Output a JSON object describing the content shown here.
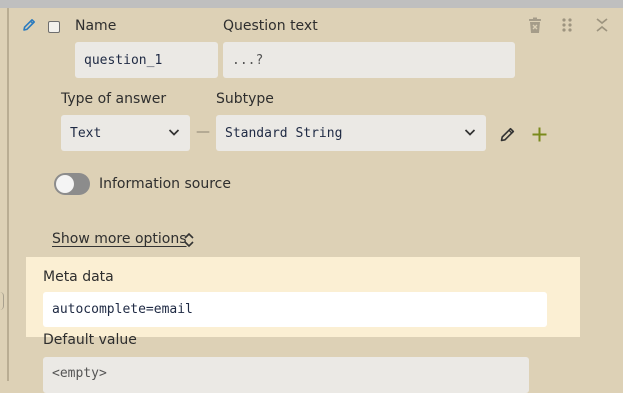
{
  "question": {
    "name_label": "Name",
    "question_text_label": "Question text",
    "name_value": "question_1",
    "question_text_placeholder": "...?"
  },
  "answer": {
    "type_label": "Type of answer",
    "subtype_label": "Subtype",
    "type_value": "Text",
    "separator": "—",
    "subtype_value": "Standard String"
  },
  "information_source": {
    "label": "Information source",
    "enabled": false
  },
  "more_options": {
    "label": "Show more options"
  },
  "meta_data": {
    "label": "Meta data",
    "value": "autocomplete=email"
  },
  "default_value": {
    "label": "Default value",
    "placeholder": "<empty>"
  },
  "icons": {
    "edit": "pencil-icon",
    "delete": "trash-icon",
    "drag": "drag-handle-icon",
    "collapse": "collapse-icon",
    "subtype_edit": "pencil-icon",
    "add": "plus-icon",
    "expand_toggle": "chevrons-icon"
  },
  "colors": {
    "card_background": "#ddd1b6",
    "highlight_panel": "#fbefd3",
    "field_background": "#ebe9e5",
    "accent_blue": "#2a7bbf",
    "accent_olive": "#7a8a1c"
  }
}
